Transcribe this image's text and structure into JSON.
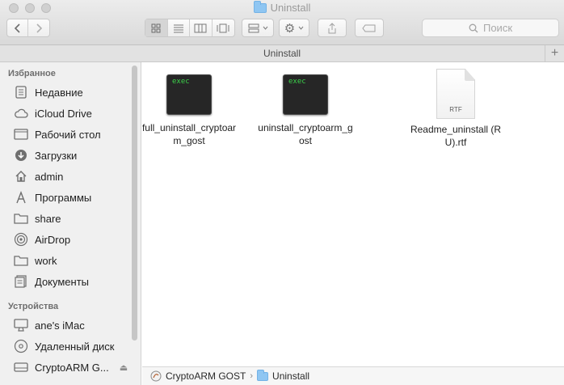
{
  "window": {
    "title": "Uninstall"
  },
  "toolbar": {
    "back_icon": "chevron-left-icon",
    "forward_icon": "chevron-right-icon",
    "view_modes": [
      "icon-view-icon",
      "list-view-icon",
      "column-view-icon",
      "gallery-view-icon"
    ],
    "active_view": "icon-view-icon",
    "search_placeholder": "Поиск"
  },
  "tab": {
    "label": "Uninstall"
  },
  "sidebar": {
    "favorites_title": "Избранное",
    "favorites": [
      {
        "label": "Недавние",
        "icon": "recents-icon"
      },
      {
        "label": "iCloud Drive",
        "icon": "cloud-icon"
      },
      {
        "label": "Рабочий стол",
        "icon": "desktop-icon"
      },
      {
        "label": "Загрузки",
        "icon": "downloads-icon"
      },
      {
        "label": "admin",
        "icon": "home-icon"
      },
      {
        "label": "Программы",
        "icon": "applications-icon"
      },
      {
        "label": "share",
        "icon": "folder-icon"
      },
      {
        "label": "AirDrop",
        "icon": "airdrop-icon"
      },
      {
        "label": "work",
        "icon": "folder-icon"
      },
      {
        "label": "Документы",
        "icon": "documents-icon"
      }
    ],
    "devices_title": "Устройства",
    "devices": [
      {
        "label": "ane's iMac",
        "icon": "imac-icon"
      },
      {
        "label": "Удаленный диск",
        "icon": "remote-disc-icon"
      },
      {
        "label": "CryptoARM G...",
        "icon": "disk-image-icon"
      }
    ]
  },
  "files": [
    {
      "name": "full_uninstall_cryptoarm_gost",
      "type": "exec",
      "badge": "exec"
    },
    {
      "name": "uninstall_cryptoarm_gost",
      "type": "exec",
      "badge": "exec"
    },
    {
      "name": "Readme_uninstall (RU).rtf",
      "type": "rtf",
      "badge": "RTF"
    }
  ],
  "pathbar": {
    "items": [
      "CryptoARM GOST",
      "Uninstall"
    ]
  }
}
